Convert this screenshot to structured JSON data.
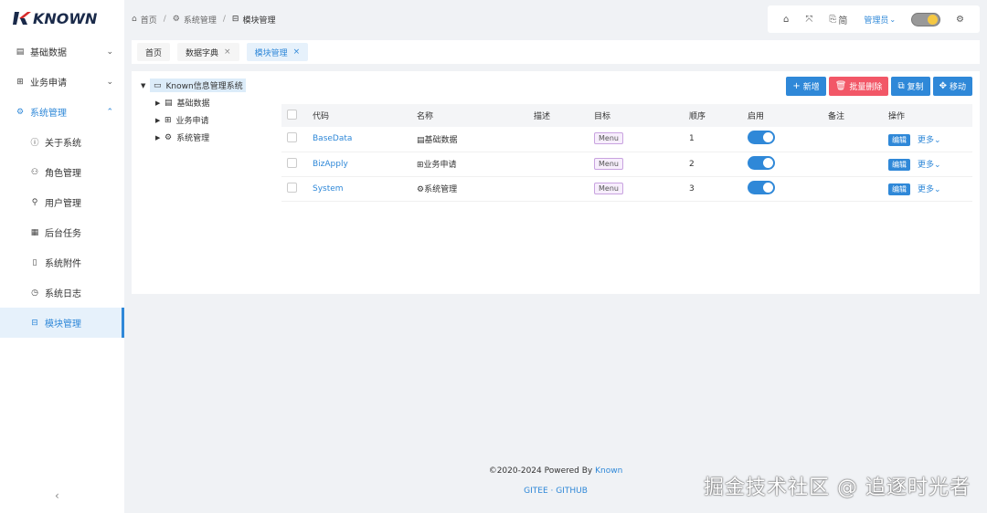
{
  "logo": {
    "text": "KNOWN"
  },
  "sidebar": {
    "items": [
      {
        "icon": "list-icon",
        "label": "基础数据",
        "expanded": false
      },
      {
        "icon": "grid-icon",
        "label": "业务申请",
        "expanded": false
      },
      {
        "icon": "gear-icon",
        "label": "系统管理",
        "expanded": true
      }
    ],
    "sub_items": [
      {
        "icon": "info-icon",
        "label": "关于系统"
      },
      {
        "icon": "users-icon",
        "label": "角色管理"
      },
      {
        "icon": "user-icon",
        "label": "用户管理"
      },
      {
        "icon": "calendar-icon",
        "label": "后台任务"
      },
      {
        "icon": "file-icon",
        "label": "系统附件"
      },
      {
        "icon": "clock-icon",
        "label": "系统日志"
      },
      {
        "icon": "module-icon",
        "label": "模块管理",
        "selected": true
      }
    ],
    "collapse_symbol": "‹"
  },
  "breadcrumb": [
    {
      "icon": "home-icon",
      "label": "首页"
    },
    {
      "icon": "gear-icon",
      "label": "系统管理"
    },
    {
      "icon": "module-icon",
      "label": "模块管理"
    }
  ],
  "header": {
    "lang_label": "简",
    "user_label": "管理员"
  },
  "tabs": [
    {
      "label": "首页",
      "closable": false
    },
    {
      "label": "数据字典",
      "closable": true
    },
    {
      "label": "模块管理",
      "closable": true,
      "active": true
    }
  ],
  "tree": {
    "root": "Known信息管理系统",
    "children": [
      "基础数据",
      "业务申请",
      "系统管理"
    ]
  },
  "actions": {
    "add": "新增",
    "batch_delete": "批量删除",
    "copy": "复制",
    "move": "移动"
  },
  "table": {
    "headers": [
      "代码",
      "名称",
      "描述",
      "目标",
      "顺序",
      "启用",
      "备注",
      "操作"
    ],
    "rows": [
      {
        "code": "BaseData",
        "name": "基础数据",
        "desc": "",
        "target": "Menu",
        "order": "1",
        "enabled": true,
        "note": ""
      },
      {
        "code": "BizApply",
        "name": "业务申请",
        "desc": "",
        "target": "Menu",
        "order": "2",
        "enabled": true,
        "note": ""
      },
      {
        "code": "System",
        "name": "系统管理",
        "desc": "",
        "target": "Menu",
        "order": "3",
        "enabled": true,
        "note": ""
      }
    ],
    "edit_label": "编辑",
    "more_label": "更多"
  },
  "footer": {
    "copyright": "©2020-2024 Powered By ",
    "brand": "Known",
    "links": "GITEE · GITHUB"
  },
  "watermark": "掘金技术社区 @ 追逐时光者",
  "colors": {
    "accent": "#2f88d8",
    "danger": "#f25767"
  }
}
